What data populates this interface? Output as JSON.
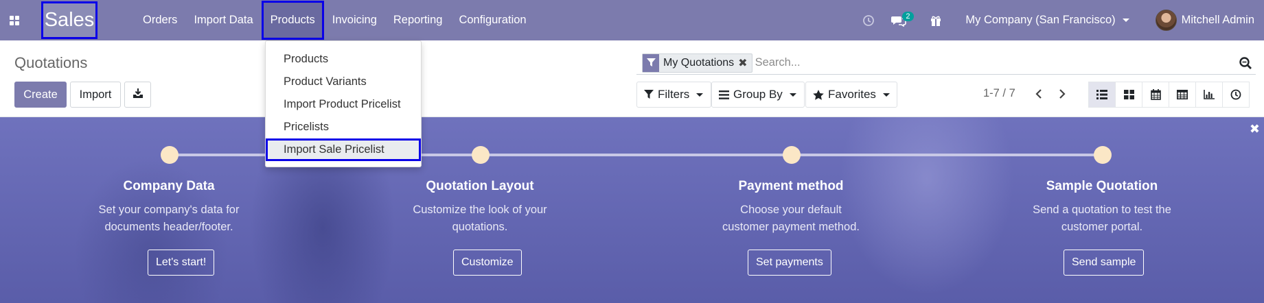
{
  "navbar": {
    "app_name": "Sales",
    "menu": [
      "Orders",
      "Import Data",
      "Products",
      "Invoicing",
      "Reporting",
      "Configuration"
    ],
    "active_menu": "Products",
    "messages_count": "2",
    "company": "My Company (San Francisco)",
    "user": "Mitchell Admin"
  },
  "products_menu": {
    "items": [
      "Products",
      "Product Variants",
      "Import Product Pricelist",
      "Pricelists",
      "Import Sale Pricelist"
    ],
    "highlighted": "Import Sale Pricelist"
  },
  "control_panel": {
    "title": "Quotations",
    "create_label": "Create",
    "import_label": "Import",
    "search": {
      "facet": "My Quotations",
      "placeholder": "Search..."
    },
    "filters_label": "Filters",
    "group_by_label": "Group By",
    "favorites_label": "Favorites",
    "pager": "1-7 / 7",
    "views": [
      "list-view-icon",
      "kanban-view-icon",
      "calendar-view-icon",
      "pivot-view-icon",
      "graph-view-icon",
      "activity-view-icon"
    ]
  },
  "onboarding": {
    "steps": [
      {
        "title": "Company Data",
        "desc": "Set your company's data for documents header/footer.",
        "button": "Let's start!"
      },
      {
        "title": "Quotation Layout",
        "desc": "Customize the look of your quotations.",
        "button": "Customize"
      },
      {
        "title": "Payment method",
        "desc": "Choose your default customer payment method.",
        "button": "Set payments"
      },
      {
        "title": "Sample Quotation",
        "desc": "Send a quotation to test the customer portal.",
        "button": "Send sample"
      }
    ]
  },
  "colors": {
    "brand": "#7c7bad",
    "highlight_border": "#0a00e8",
    "banner": "#5f62ae",
    "step_dot": "#fbe7c6",
    "badge": "#00a09d"
  }
}
